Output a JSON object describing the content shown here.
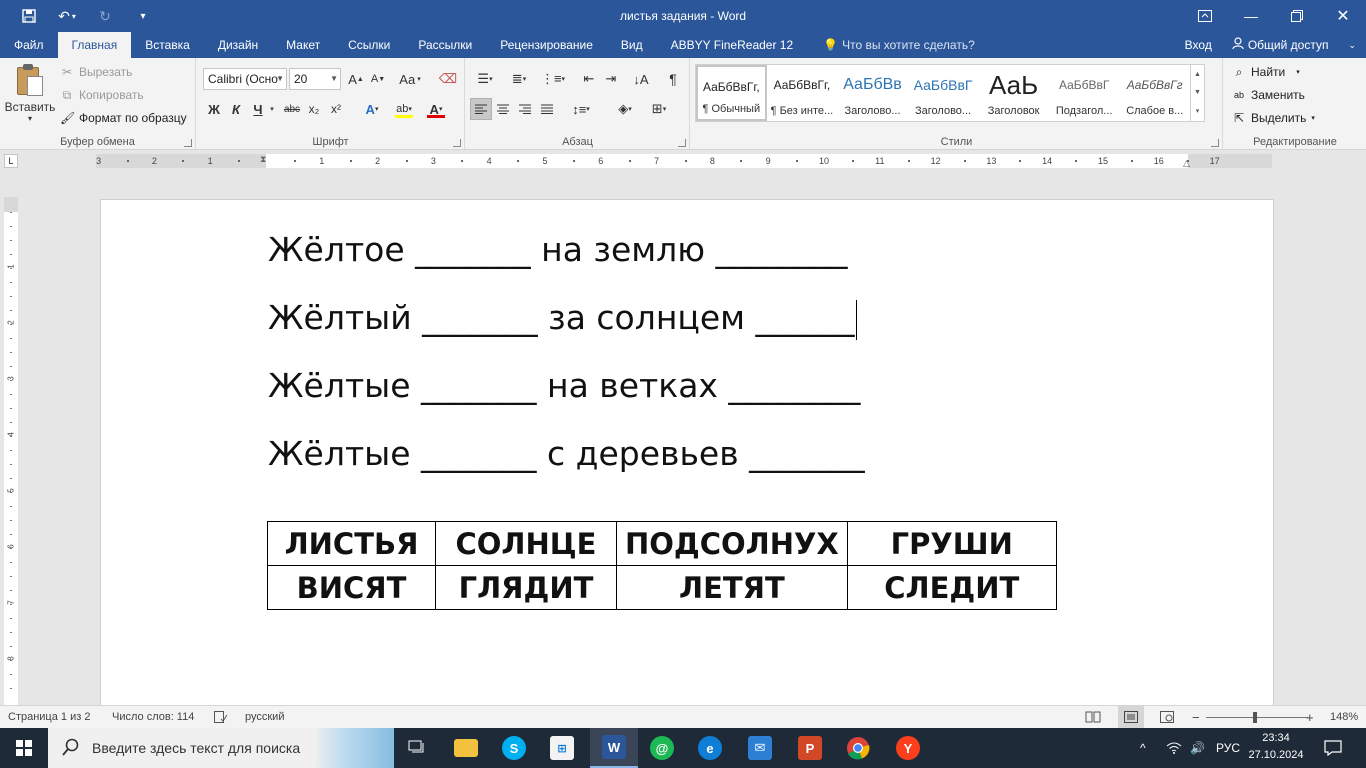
{
  "titlebar": {
    "title": "листья  задания - Word"
  },
  "tabs": {
    "file": "Файл",
    "items": [
      "Главная",
      "Вставка",
      "Дизайн",
      "Макет",
      "Ссылки",
      "Рассылки",
      "Рецензирование",
      "Вид",
      "ABBYY FineReader 12"
    ],
    "tell_me": "Что вы хотите сделать?",
    "signin": "Вход",
    "share": "Общий доступ"
  },
  "clipboard": {
    "paste": "Вставить",
    "cut": "Вырезать",
    "copy": "Копировать",
    "format_painter": "Формат по образцу",
    "label": "Буфер обмена"
  },
  "font": {
    "name": "Calibri (Осно",
    "size": "20",
    "case_btn": "Aa",
    "bold": "Ж",
    "italic": "К",
    "underline": "Ч",
    "strike": "abc",
    "sub": "x₂",
    "sup": "x²",
    "label": "Шрифт",
    "highlight_color": "#ffff00",
    "font_color": "#e00000"
  },
  "paragraph": {
    "label": "Абзац"
  },
  "styles": {
    "label": "Стили",
    "items": [
      {
        "sample": "АаБбВвГг,",
        "name": "¶ Обычный"
      },
      {
        "sample": "АаБбВвГг,",
        "name": "¶ Без инте..."
      },
      {
        "sample": "АаБбВв",
        "name": "Заголово..."
      },
      {
        "sample": "АаБбВвГ",
        "name": "Заголово..."
      },
      {
        "sample": "АаЬ",
        "name": "Заголовок"
      },
      {
        "sample": "АаБбВвГ",
        "name": "Подзагол..."
      },
      {
        "sample": "АаБбВвГг",
        "name": "Слабое в..."
      }
    ]
  },
  "editing": {
    "find": "Найти",
    "replace": "Заменить",
    "select": "Выделить",
    "label": "Редактирование"
  },
  "ruler": {
    "numbers": [
      "3",
      "2",
      "1",
      "1",
      "2",
      "3",
      "4",
      "5",
      "6",
      "7",
      "8",
      "9",
      "10",
      "11",
      "12",
      "13",
      "14",
      "15",
      "16",
      "17"
    ],
    "vnumbers": [
      "1",
      "2",
      "3",
      "4",
      "5",
      "6",
      "7",
      "8"
    ],
    "tab_selector": "L"
  },
  "document": {
    "lines": [
      "Жёлтое _______ на землю ________",
      "Жёлтый _______ за солнцем ______",
      "Жёлтые _______ на ветках ________",
      "Жёлтые _______ с деревьев _______"
    ],
    "table": [
      [
        "ЛИСТЬЯ",
        "СОЛНЦЕ",
        "ПОДСОЛНУХ",
        "ГРУШИ"
      ],
      [
        "ВИСЯТ",
        "ГЛЯДИТ",
        "ЛЕТЯТ",
        "СЛЕДИТ"
      ]
    ]
  },
  "status": {
    "page": "Страница 1 из 2",
    "words": "Число слов: 114",
    "language": "русский",
    "zoom": "148%",
    "zoom_fraction": 0.48
  },
  "taskbar": {
    "search_placeholder": "Введите здесь текст для поиска",
    "lang": "РУС",
    "time": "23:34",
    "date": "27.10.2024"
  }
}
